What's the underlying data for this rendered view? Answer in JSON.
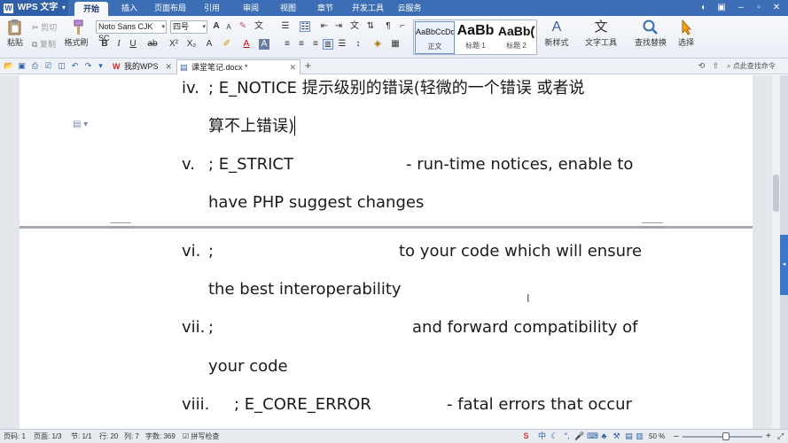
{
  "app": {
    "name": "WPS 文字",
    "logo": "W"
  },
  "menu": {
    "tabs": [
      "开始",
      "插入",
      "页面布局",
      "引用",
      "审阅",
      "视图",
      "章节",
      "开发工具",
      "云服务"
    ],
    "active": "开始"
  },
  "ribbon": {
    "paste": "粘贴",
    "cut": "剪切",
    "copy": "复制",
    "format_painter": "格式刷",
    "font_name": "Noto Sans CJK SC",
    "font_size": "四号",
    "styles": [
      {
        "sample": "AaBbCcDd",
        "name": "正文"
      },
      {
        "sample": "AaBb",
        "name": "标题 1"
      },
      {
        "sample": "AaBb(",
        "name": "标题 2"
      }
    ],
    "new_style": "新样式",
    "text_tools": "文字工具",
    "find_replace": "查找替换",
    "select": "选择"
  },
  "tabbar": {
    "tabs": [
      {
        "label": "我的WPS",
        "active": false
      },
      {
        "label": "课堂笔记.docx *",
        "active": true
      }
    ],
    "search_hint": "点此查找命令"
  },
  "document": {
    "lines": [
      {
        "num": "iv.",
        "text": "; E_NOTICE    提示级别的错误(轻微的一个错误  或者说"
      },
      {
        "num": "",
        "text": "算不上错误)"
      },
      {
        "num": "v.",
        "text": "; E_STRICT",
        "right": "- run-time notices, enable to"
      },
      {
        "num": "",
        "text": "have PHP suggest changes"
      },
      {
        "num": "vi.",
        "text": ";",
        "right": "to your code which will ensure"
      },
      {
        "num": "",
        "text": "the best interoperability"
      },
      {
        "num": "vii.",
        "text": ";",
        "right": "and forward compatibility of"
      },
      {
        "num": "",
        "text": "your code"
      },
      {
        "num": "viii.",
        "text": "; E_CORE_ERROR",
        "right": "- fatal errors that occur"
      }
    ]
  },
  "status": {
    "page": "页码: 1",
    "pages": "页面: 1/3",
    "section": "节: 1/1",
    "row": "行: 20",
    "col": "列: 7",
    "words": "字数: 369",
    "spellcheck": "拼写检查",
    "zoom": "50 %"
  },
  "colors": {
    "accent": "#3c6eb5",
    "page": "#ffffff",
    "canvas": "#e3e6eb"
  }
}
